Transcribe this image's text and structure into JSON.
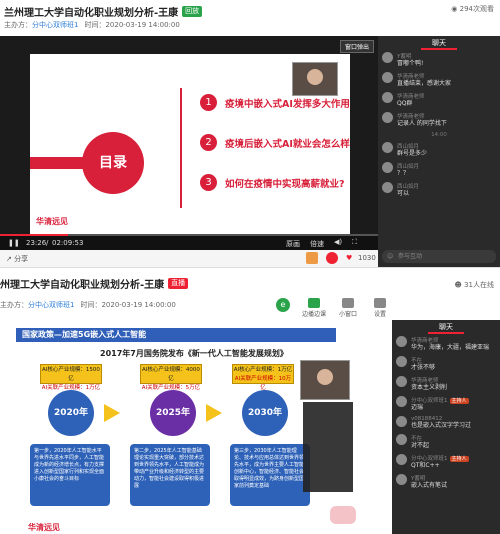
{
  "screen1": {
    "title": "兰州理工大学自动化职业规划分析-王康",
    "live_tag": "回放",
    "host_label": "主办方：",
    "host": "分中心双师班1",
    "time": "时间：2020-03-19 14:00:00",
    "online": "294次观看",
    "window_button": "窗口弹出",
    "slide": {
      "category": "目录",
      "items": [
        {
          "num": "1",
          "text": "疫境中嵌入式AI发挥多大作用?"
        },
        {
          "num": "2",
          "text": "疫境后嵌入式AI就业会怎么样?"
        },
        {
          "num": "3",
          "text": "如何在疫情中实现高薪就业?"
        }
      ],
      "brand": "华清远见"
    },
    "controls": {
      "elapsed": "23:26",
      "duration": "02:09:53",
      "quality": "原画",
      "speed": "倍速",
      "progress": 0.18
    },
    "share": "分享",
    "likes": "1030",
    "chat": {
      "header": "聊天",
      "input_placeholder": "参与互动",
      "messages": [
        {
          "name": "Y蓄明",
          "text": "冒嘟个鸭!"
        },
        {
          "name": "华清商老师",
          "text": "直播结束，感谢大家"
        },
        {
          "name": "华清商老师",
          "text": "QQ群"
        },
        {
          "name": "华清商老师",
          "text": "记录人 的同学找下"
        },
        {
          "name": "西山如月",
          "text": "群号是多少"
        },
        {
          "name": "西山如月",
          "text": "？？"
        },
        {
          "name": "西山如月",
          "text": "可以"
        }
      ],
      "time_divider": "14:00"
    }
  },
  "screen2": {
    "title": "州理工大学自动化职业规划分析-王康",
    "live_tag": "直播",
    "host_label": "主办方：",
    "host": "分中心双师班1",
    "time": "时间：2020-03-19 14:00:00",
    "online": "31人在线",
    "toolbar": [
      "边播边课",
      "小窗口",
      "设置"
    ],
    "slide": {
      "banner": "国家政策—加速5G嵌入式人工智能",
      "subtitle": "2017年7月国务院发布《新一代人工智能发展规划》",
      "boxes": [
        {
          "l1": "AI核心产业规模：1500亿",
          "l2": "AI关联产业规模：1万亿"
        },
        {
          "l1": "AI核心产业规模：4000亿",
          "l2": "AI关联产业规模：5万亿"
        },
        {
          "l1": "AI核心产业规模：1万亿",
          "l2": "AI关联产业规模：10万亿"
        }
      ],
      "years": [
        "2020年",
        "2025年",
        "2030年"
      ],
      "steps": [
        "第一步，2020年人工智能水平与世界先进水平同步，人工智能成为新的经济增长点，有力支撑进入创新型国家行列和实现全面小康社会的奋斗目标",
        "第二步，2025年人工智能基础理论实现重大突破，部分技术达到世界领先水平，人工智能成为带动产业升级和经济转型的主要动力，智能社会建设取得积极进展",
        "第三步，2030年人工智能理论、技术与应用总体达到世界领先水平，成为世界主要人工智能创新中心，智能经济、智能社会取得明显成效，为跻身创新型国家前列奠定基础"
      ],
      "brand": "华清远见"
    },
    "chat": {
      "header": "聊天",
      "messages": [
        {
          "name": "华清商老师",
          "text": "华为，海康，大疆，福建亚瑞"
        },
        {
          "name": "不在",
          "text": "才张不够"
        },
        {
          "name": "华清商老师",
          "text": "资本主义剥削"
        },
        {
          "name": "分中心双师班1",
          "text": "迈瑞",
          "tag": "主持人"
        },
        {
          "name": "v08188412",
          "text": "也是嵌入式汉字学习过"
        },
        {
          "name": "不在",
          "text": "对不起"
        },
        {
          "name": "分中心双师班1",
          "text": "QT和C++",
          "tag": "主持人"
        },
        {
          "name": "Y蓄明",
          "text": "嵌入式有笔试"
        }
      ]
    }
  },
  "colors": {
    "brand_red": "#d8203a",
    "link_blue": "#2b7cd6",
    "policy_blue": "#2e62b8",
    "year_purple": "#6a2ea5",
    "year_gold": "#f4c21a"
  }
}
